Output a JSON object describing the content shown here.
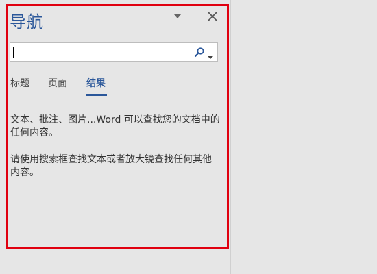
{
  "pane": {
    "title": "导航"
  },
  "search": {
    "value": "",
    "placeholder": ""
  },
  "tabs": [
    {
      "label": "标题",
      "active": false
    },
    {
      "label": "页面",
      "active": false
    },
    {
      "label": "结果",
      "active": true
    }
  ],
  "results": {
    "message_1": "文本、批注、图片...Word 可以查找您的文档中的任何内容。",
    "message_2": "请使用搜索框查找文本或者放大镜查找任何其他内容。"
  },
  "colors": {
    "accent": "#2b579a",
    "highlight": "#e0000f",
    "background": "#e6e6e6"
  },
  "icons": {
    "pane_options": "chevron-down-icon",
    "close": "close-icon",
    "search": "magnifier-icon",
    "search_options": "chevron-down-icon"
  }
}
